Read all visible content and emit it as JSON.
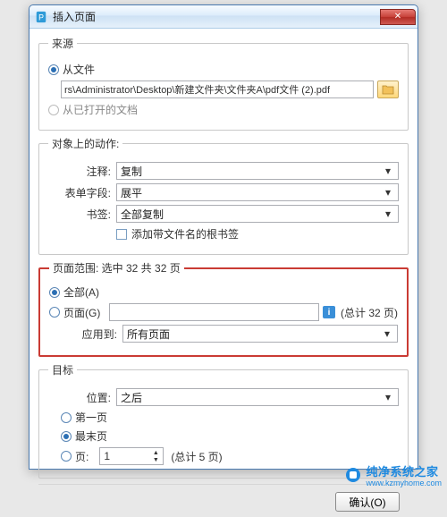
{
  "window": {
    "title": "插入页面",
    "close": "✕"
  },
  "source": {
    "legend": "来源",
    "from_file_label": "从文件",
    "path": "rs\\Administrator\\Desktop\\新建文件夹\\文件夹A\\pdf文件 (2).pdf",
    "from_open_label": "从已打开的文档"
  },
  "actions": {
    "legend": "对象上的动作:",
    "annot_lbl": "注释:",
    "annot_val": "复制",
    "form_lbl": "表单字段:",
    "form_val": "展平",
    "bm_lbl": "书签:",
    "bm_val": "全部复制",
    "chk_lbl": "添加带文件名的根书签"
  },
  "range": {
    "legend": "页面范围: 选中 32 共 32 页",
    "all_lbl": "全部(A)",
    "pages_lbl": "页面(G)",
    "pages_val": "",
    "total_lbl": "(总计 32 页)",
    "apply_lbl": "应用到:",
    "apply_val": "所有页面"
  },
  "dest": {
    "legend": "目标",
    "pos_lbl": "位置:",
    "pos_val": "之后",
    "first_lbl": "第一页",
    "last_lbl": "最末页",
    "page_lbl": "页:",
    "page_val": "1",
    "total_lbl": "(总计 5 页)"
  },
  "buttons": {
    "ok": "确认(O)"
  },
  "watermark": {
    "line1": "纯净系统之家",
    "line2": "www.kzmyhome.com"
  }
}
